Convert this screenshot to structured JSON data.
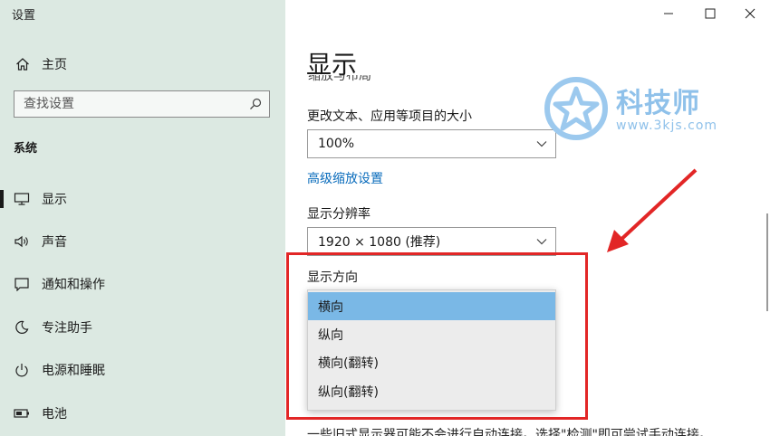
{
  "window": {
    "title": "设置"
  },
  "sidebar": {
    "home_label": "主页",
    "search": {
      "placeholder": "查找设置"
    },
    "section_label": "系统",
    "items": [
      {
        "label": "显示",
        "icon": "monitor-icon",
        "active": true
      },
      {
        "label": "声音",
        "icon": "speaker-icon"
      },
      {
        "label": "通知和操作",
        "icon": "notification-icon"
      },
      {
        "label": "专注助手",
        "icon": "moon-icon"
      },
      {
        "label": "电源和睡眠",
        "icon": "power-icon"
      },
      {
        "label": "电池",
        "icon": "battery-icon"
      }
    ]
  },
  "main": {
    "title": "显示",
    "partial_text": "缩放与布局",
    "scale_label": "更改文本、应用等项目的大小",
    "scale_value": "100%",
    "advanced_link": "高级缩放设置",
    "resolution_label": "显示分辨率",
    "resolution_value": "1920 × 1080 (推荐)",
    "orientation_label": "显示方向",
    "orientation_options": [
      "横向",
      "纵向",
      "横向(翻转)",
      "纵向(翻转)"
    ],
    "orientation_selected": "横向",
    "bottom_text": "一些旧式显示器可能不会进行自动连接。选择\"检测\"即可尝试手动连接。"
  },
  "watermark": {
    "brand": "科技师",
    "url": "www.3kjs.com"
  },
  "colors": {
    "sidebar_bg": "#dce9e2",
    "link": "#0a6cbc",
    "selected": "#7ab8e6",
    "highlight_box": "#e22626"
  }
}
